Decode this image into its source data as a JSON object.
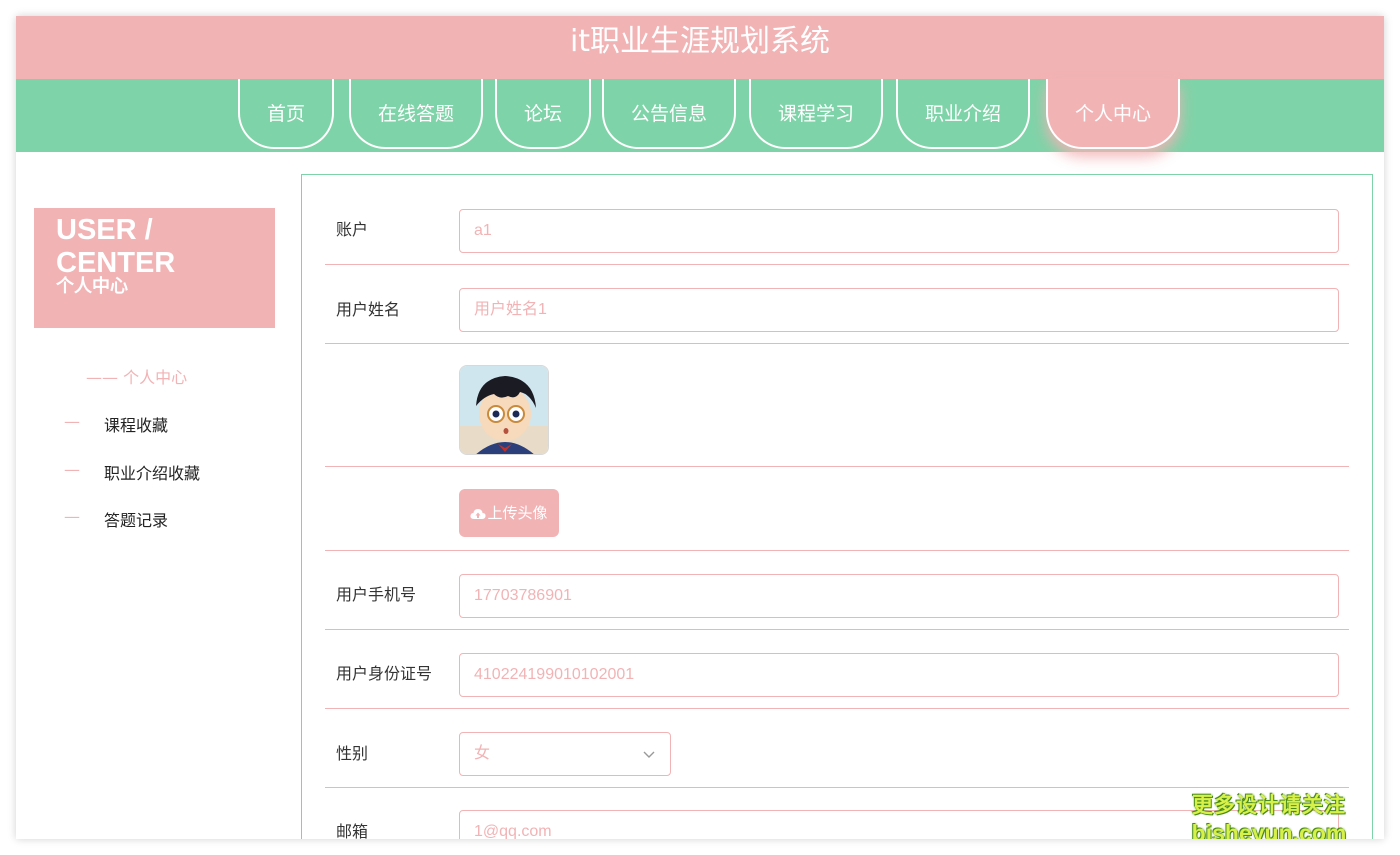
{
  "app_title": "it职业生涯规划系统",
  "nav": {
    "items": [
      {
        "label": "首页"
      },
      {
        "label": "在线答题"
      },
      {
        "label": "论坛"
      },
      {
        "label": "公告信息"
      },
      {
        "label": "课程学习"
      },
      {
        "label": "职业介绍"
      },
      {
        "label": "个人中心"
      }
    ],
    "active_index": 6
  },
  "sidebar": {
    "title_en": "USER / CENTER",
    "title_cn": "个人中心",
    "active_item": "—— 个人中心",
    "dash": "—",
    "items": [
      {
        "label": "课程收藏"
      },
      {
        "label": "职业介绍收藏"
      },
      {
        "label": "答题记录"
      }
    ]
  },
  "form": {
    "account": {
      "label": "账户",
      "value": "a1"
    },
    "username": {
      "label": "用户姓名",
      "value": "用户姓名1"
    },
    "upload_avatar_label": "上传头像",
    "phone": {
      "label": "用户手机号",
      "value": "17703786901"
    },
    "id_card": {
      "label": "用户身份证号",
      "value": "410224199010102001"
    },
    "gender": {
      "label": "性别",
      "value": "女"
    },
    "email": {
      "label": "邮箱",
      "value": "1@qq.com"
    }
  },
  "watermark": {
    "line1": "更多设计请关注",
    "line2": "bisheyun.com"
  },
  "colors": {
    "primary_pink": "#f2b3b5",
    "accent_green": "#7fd3a8"
  },
  "icons": [
    "cloud-upload-icon",
    "chevron-down-icon",
    "avatar"
  ]
}
